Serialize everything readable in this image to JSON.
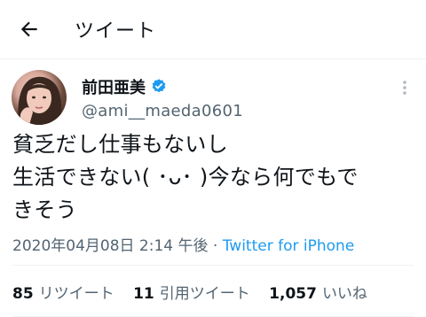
{
  "header": {
    "title": "ツイート",
    "back_icon": "arrow-left-icon"
  },
  "tweet": {
    "display_name": "前田亜美",
    "handle": "@ami__maeda0601",
    "text": "貧乏だし仕事もないし\n生活できない( ･ᴗ･ )今なら何でもで\nきそう",
    "timestamp": "2020年04月08日 2:14 午後",
    "separator": "·",
    "source": "Twitter for iPhone",
    "verified_color": "#1d9bf0"
  },
  "stats": {
    "retweets": {
      "count": "85",
      "label": "リツイート"
    },
    "quotes": {
      "count": "11",
      "label": "引用ツイート"
    },
    "likes": {
      "count": "1,057",
      "label": "いいね"
    }
  }
}
